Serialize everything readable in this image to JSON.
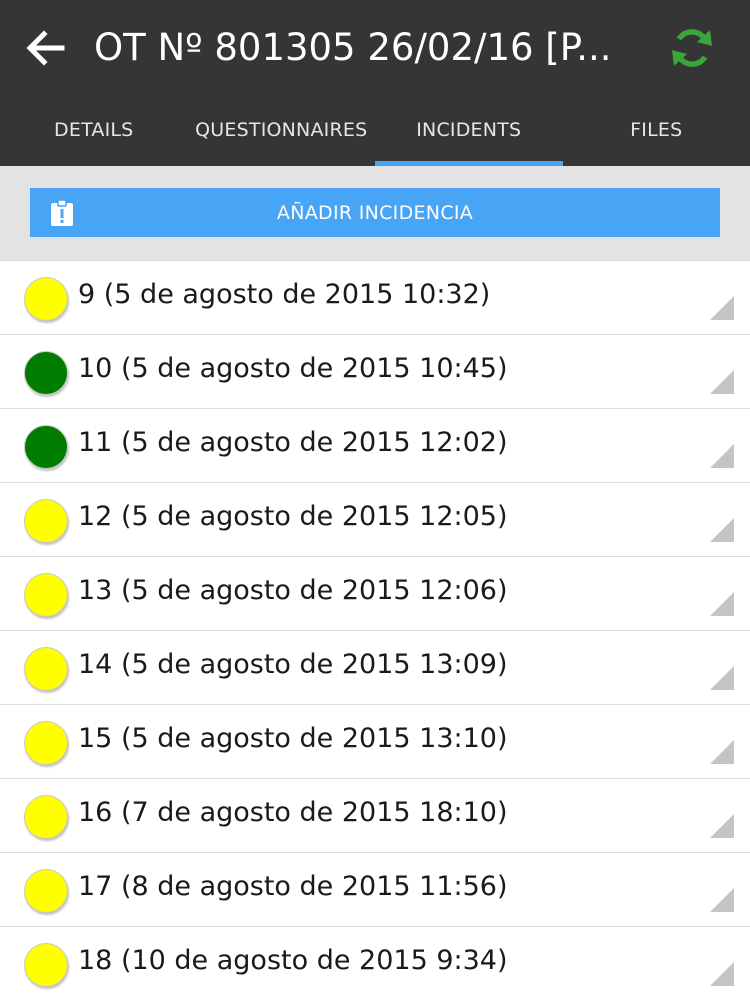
{
  "header": {
    "title": "OT Nº 801305 26/02/16 [P...",
    "back_icon": "arrow-left-icon",
    "refresh_icon": "refresh-icon",
    "colors": {
      "bar": "#353535",
      "refresh": "#3aa53a"
    }
  },
  "tabs": [
    {
      "label": "DETAILS",
      "active": false
    },
    {
      "label": "QUESTIONNAIRES",
      "active": false
    },
    {
      "label": "INCIDENTS",
      "active": true
    },
    {
      "label": "FILES",
      "active": false
    }
  ],
  "actions": {
    "add_label": "AÑADIR INCIDENCIA",
    "add_icon": "clipboard-alert-icon",
    "color": "#48a4f5"
  },
  "status_colors": {
    "yellow": "#ffff00",
    "green": "#007d00"
  },
  "incidents": [
    {
      "label": "9 (5 de agosto de 2015 10:32)",
      "status": "yellow"
    },
    {
      "label": "10 (5 de agosto de 2015 10:45)",
      "status": "green"
    },
    {
      "label": "11 (5 de agosto de 2015 12:02)",
      "status": "green"
    },
    {
      "label": "12 (5 de agosto de 2015 12:05)",
      "status": "yellow"
    },
    {
      "label": "13 (5 de agosto de 2015 12:06)",
      "status": "yellow"
    },
    {
      "label": "14 (5 de agosto de 2015 13:09)",
      "status": "yellow"
    },
    {
      "label": "15 (5 de agosto de 2015 13:10)",
      "status": "yellow"
    },
    {
      "label": "16 (7 de agosto de 2015 18:10)",
      "status": "yellow"
    },
    {
      "label": "17 (8 de agosto de 2015 11:56)",
      "status": "yellow"
    },
    {
      "label": "18 (10 de agosto de 2015 9:34)",
      "status": "yellow"
    }
  ]
}
